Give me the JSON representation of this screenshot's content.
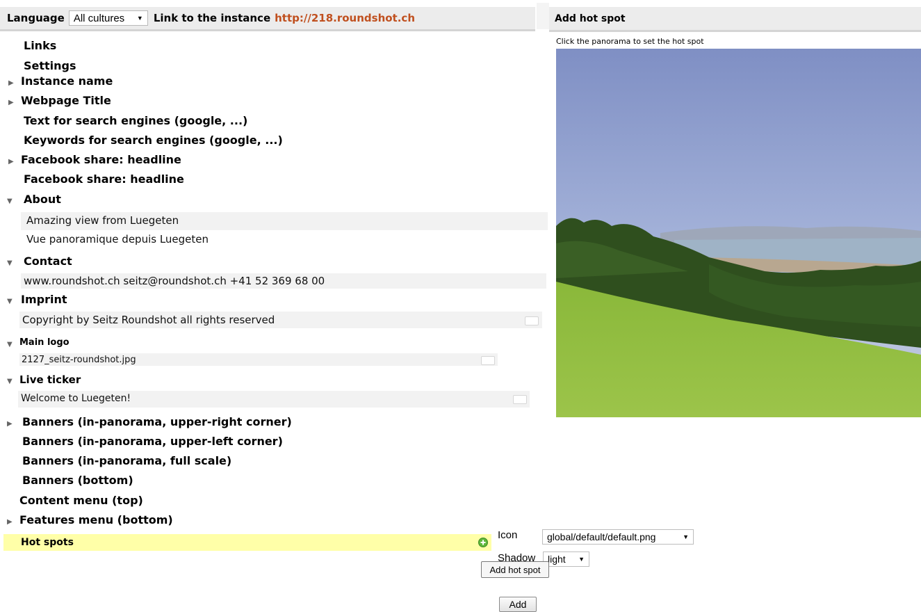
{
  "topbar": {
    "language_label": "Language",
    "language_value": "All cultures",
    "link_label": "Link to the instance",
    "link_url": "http://218.roundshot.ch"
  },
  "right_panel": {
    "title": "Add hot spot",
    "hint": "Click the panorama to set the hot spot"
  },
  "tree": {
    "links": "Links",
    "settings": "Settings",
    "instance_name": "Instance name",
    "webpage_title": "Webpage Title",
    "text_search": "Text for search engines (google, ...)",
    "keywords_search": "Keywords for search engines (google, ...)",
    "fb_headline_1": "Facebook share: headline",
    "fb_headline_2": "Facebook share: headline",
    "about": "About",
    "about_line1": "Amazing view from Luegeten",
    "about_line2": "Vue panoramique depuis Luegeten",
    "contact": "Contact",
    "contact_value": "www.roundshot.ch seitz@roundshot.ch +41 52 369 68 00",
    "imprint": "Imprint",
    "imprint_value": "Copyright by Seitz Roundshot all rights reserved",
    "main_logo": "Main logo",
    "main_logo_value": "2127_seitz-roundshot.jpg",
    "live_ticker": "Live ticker",
    "live_ticker_value": "Welcome to Luegeten!",
    "banners_upper_right": "Banners (in-panorama, upper-right corner)",
    "banners_upper_left": "Banners (in-panorama, upper-left corner)",
    "banners_full": "Banners (in-panorama, full scale)",
    "banners_bottom": "Banners (bottom)",
    "content_menu": "Content menu (top)",
    "features_menu": "Features menu (bottom)",
    "hot_spots": "Hot spots"
  },
  "form": {
    "icon_label": "Icon",
    "icon_value": "global/default/default.png",
    "shadow_label": "Shadow",
    "shadow_value": "light",
    "tooltip": "Add hot spot",
    "add_button": "Add"
  },
  "colors": {
    "link": "#c0501f",
    "highlight_row": "#ffffa8"
  }
}
